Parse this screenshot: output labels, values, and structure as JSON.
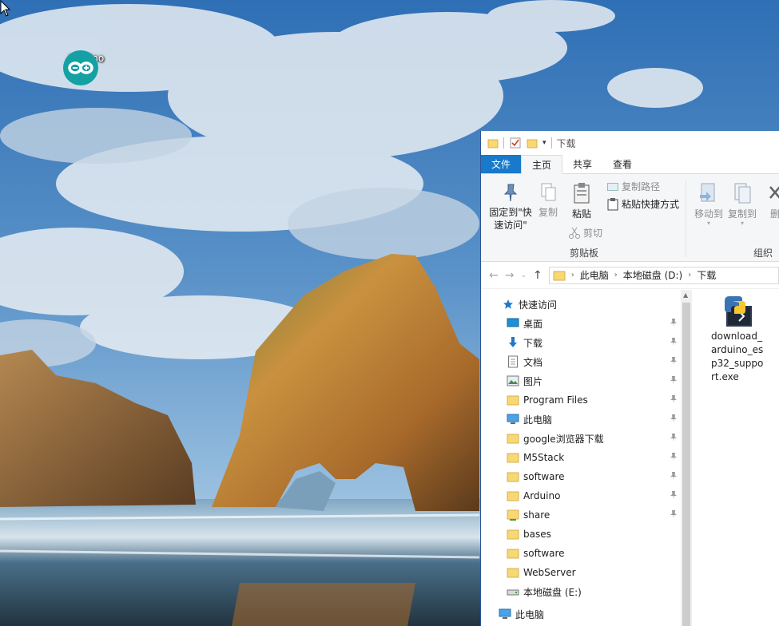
{
  "desktop": {
    "icons": [
      {
        "label": "Arduino",
        "icon": "arduino-logo-icon"
      }
    ]
  },
  "explorer": {
    "title": "下载",
    "tabs": {
      "file": "文件",
      "home": "主页",
      "share": "共享",
      "view": "查看"
    },
    "ribbon": {
      "pin_quick_access": "固定到\"快速访问\"",
      "copy": "复制",
      "paste": "粘贴",
      "copy_path": "复制路径",
      "paste_shortcut": "粘贴快捷方式",
      "cut": "剪切",
      "clipboard_group": "剪贴板",
      "move_to": "移动到",
      "copy_to": "复制到",
      "delete": "删",
      "organize_group": "组织"
    },
    "address": {
      "segments": [
        "此电脑",
        "本地磁盘 (D:)",
        "下载"
      ]
    },
    "nav": {
      "quick_access": "快速访问",
      "items": [
        {
          "label": "桌面",
          "icon": "desktop-icon",
          "pinned": true
        },
        {
          "label": "下载",
          "icon": "download-arrow-icon",
          "pinned": true
        },
        {
          "label": "文档",
          "icon": "documents-icon",
          "pinned": true
        },
        {
          "label": "图片",
          "icon": "pictures-icon",
          "pinned": true
        },
        {
          "label": "Program Files",
          "icon": "folder-icon",
          "pinned": true
        },
        {
          "label": "此电脑",
          "icon": "computer-icon",
          "pinned": true
        },
        {
          "label": "google浏览器下载",
          "icon": "folder-icon",
          "pinned": true
        },
        {
          "label": "M5Stack",
          "icon": "folder-icon",
          "pinned": true
        },
        {
          "label": "software",
          "icon": "folder-icon",
          "pinned": true
        },
        {
          "label": "Arduino",
          "icon": "folder-icon",
          "pinned": true
        },
        {
          "label": "share",
          "icon": "shared-folder-icon",
          "pinned": true
        },
        {
          "label": "bases",
          "icon": "folder-icon",
          "pinned": false
        },
        {
          "label": "software",
          "icon": "folder-icon",
          "pinned": false
        },
        {
          "label": "WebServer",
          "icon": "folder-icon",
          "pinned": false
        },
        {
          "label": "本地磁盘 (E:)",
          "icon": "drive-icon",
          "pinned": false
        }
      ],
      "this_pc": "此电脑"
    },
    "files": [
      {
        "name": "download_arduino_esp32_support.exe",
        "icon": "python-exe-icon"
      }
    ]
  },
  "colors": {
    "file_tab": "#1979ca",
    "folder": "#f8d775",
    "quick_access_star": "#1e78c8"
  }
}
